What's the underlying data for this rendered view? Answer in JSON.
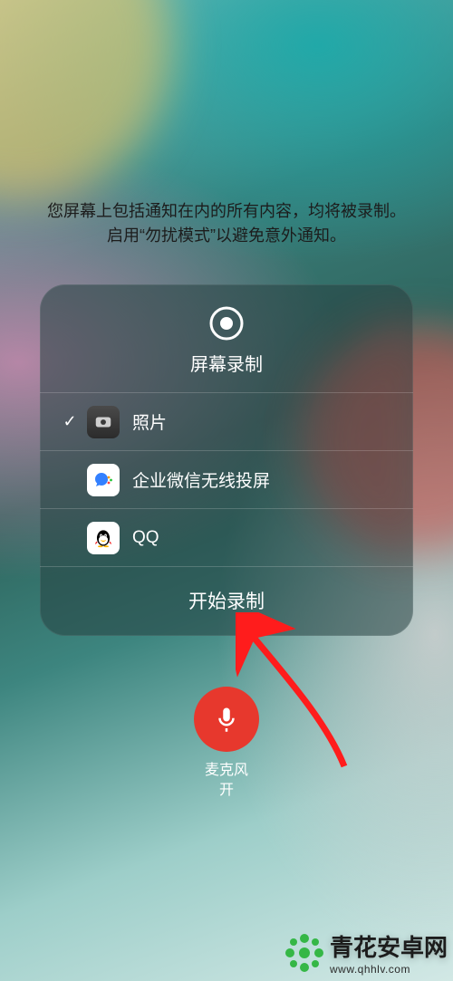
{
  "info": {
    "line1": "您屏幕上包括通知在内的所有内容，均将被录制。",
    "line2": "启用“勿扰模式”以避免意外通知。"
  },
  "sheet": {
    "title": "屏幕录制",
    "options": [
      {
        "label": "照片",
        "selected": true
      },
      {
        "label": "企业微信无线投屏",
        "selected": false
      },
      {
        "label": "QQ",
        "selected": false
      }
    ],
    "action_label": "开始录制"
  },
  "mic": {
    "label_line1": "麦克风",
    "label_line2": "开"
  },
  "watermark": {
    "brand": "青花安卓网",
    "url": "www.qhhlv.com"
  },
  "colors": {
    "mic_bg": "#e03a2f",
    "arrow": "#ff1e1e"
  }
}
